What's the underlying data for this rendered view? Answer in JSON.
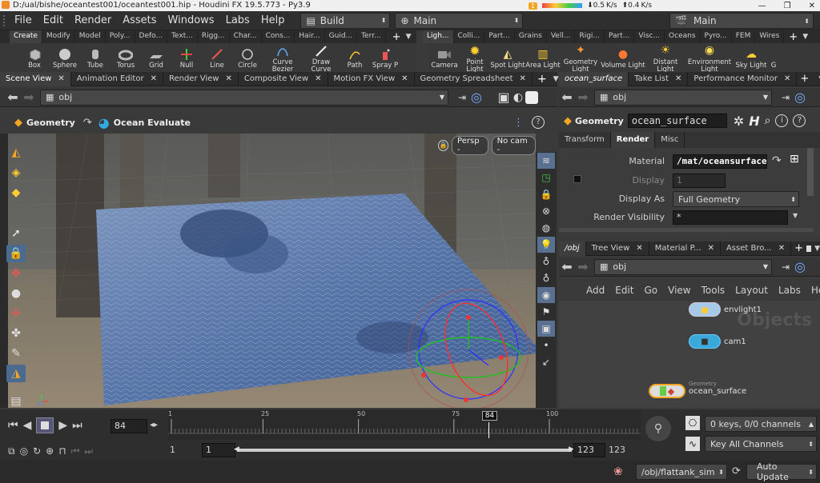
{
  "window": {
    "title": "D:/ual/bishe/oceantest001/oceantest001.hip - Houdini FX 19.5.773 - Py3.9",
    "sys_down": "0.5",
    "sys_up": "0.4",
    "sys_unit": "K/s"
  },
  "menu": {
    "items": [
      "File",
      "Edit",
      "Render",
      "Assets",
      "Windows",
      "Labs",
      "Help"
    ],
    "desktop": "Build",
    "network": "Main",
    "right_desktop": "Main"
  },
  "shelf_left": {
    "tabs": [
      "Create",
      "Modify",
      "Model",
      "Poly...",
      "Defo...",
      "Text...",
      "Rigg...",
      "Char...",
      "Cons...",
      "Hair...",
      "Guid...",
      "Terr..."
    ],
    "tools": [
      {
        "label": "Box",
        "icon": "box-icon"
      },
      {
        "label": "Sphere",
        "icon": "sphere-icon"
      },
      {
        "label": "Tube",
        "icon": "tube-icon"
      },
      {
        "label": "Torus",
        "icon": "torus-icon"
      },
      {
        "label": "Grid",
        "icon": "grid-icon"
      },
      {
        "label": "Null",
        "icon": "null-icon"
      },
      {
        "label": "Line",
        "icon": "line-icon"
      },
      {
        "label": "Circle",
        "icon": "circle-icon"
      },
      {
        "label": "Curve Bezier",
        "icon": "curve-bezier-icon"
      },
      {
        "label": "Draw Curve",
        "icon": "draw-curve-icon"
      },
      {
        "label": "Path",
        "icon": "path-icon"
      },
      {
        "label": "Spray P",
        "icon": "spray-paint-icon"
      }
    ]
  },
  "shelf_right": {
    "tabs": [
      "Ligh...",
      "Colli...",
      "Part...",
      "Grains",
      "Vell...",
      "Rigi...",
      "Part...",
      "Visc...",
      "Oceans",
      "Pyro...",
      "FEM",
      "Wires"
    ],
    "tools": [
      {
        "label": "Camera",
        "icon": "camera-icon"
      },
      {
        "label": "Point Light",
        "icon": "point-light-icon"
      },
      {
        "label": "Spot Light",
        "icon": "spot-light-icon"
      },
      {
        "label": "Area Light",
        "icon": "area-light-icon"
      },
      {
        "label": "Geometry Light",
        "icon": "geometry-light-icon"
      },
      {
        "label": "Volume Light",
        "icon": "volume-light-icon"
      },
      {
        "label": "Distant Light",
        "icon": "distant-light-icon"
      },
      {
        "label": "Environment Light",
        "icon": "environment-light-icon"
      },
      {
        "label": "Sky Light",
        "icon": "sky-light-icon"
      },
      {
        "label": "G",
        "icon": "more-icon"
      }
    ]
  },
  "left_panes": {
    "tabs": [
      "Scene View",
      "Animation Editor",
      "Render View",
      "Composite View",
      "Motion FX View",
      "Geometry Spreadsheet"
    ],
    "path": "obj"
  },
  "viewport": {
    "context": "Geometry",
    "node": "Ocean Evaluate",
    "camera": "Persp -",
    "cam_menu": "No cam -"
  },
  "params": {
    "tabs": [
      "ocean_surface",
      "Take List",
      "Performance Monitor"
    ],
    "path": "obj",
    "type": "Geometry",
    "node_name": "ocean_surface",
    "subtabs": [
      "Transform",
      "Render",
      "Misc"
    ],
    "material_label": "Material",
    "material_value": "/mat/oceansurface",
    "display_label": "Display",
    "display_value": "1",
    "display_as_label": "Display As",
    "display_as_value": "Full Geometry",
    "render_vis_label": "Render Visibility",
    "render_vis_value": "*"
  },
  "network": {
    "tabs": [
      "/obj",
      "Tree View",
      "Material P...",
      "Asset Bro..."
    ],
    "path": "obj",
    "menu": [
      "Add",
      "Edit",
      "Go",
      "View",
      "Tools",
      "Layout",
      "Labs",
      "Help"
    ],
    "watermark": "Objects",
    "nodes": [
      {
        "name": "envlight1",
        "icon": "envlight-icon"
      },
      {
        "name": "cam1",
        "icon": "camera-node-icon"
      },
      {
        "name": "ocean_surface",
        "type": "Geometry",
        "icon": "geometry-node-icon"
      }
    ]
  },
  "timeline": {
    "frame": "84",
    "ticks": [
      "1",
      "25",
      "50",
      "75",
      "100"
    ],
    "marker": "84",
    "range_start": "1",
    "start": "1",
    "end": "123",
    "range_end": "123",
    "current_frame": 84,
    "last_frame": 123
  },
  "channels": {
    "keys": "0 keys, 0/0 channels",
    "key_all": "Key All Channels"
  },
  "status": {
    "path": "/obj/flattank_sim",
    "update": "Auto Update"
  },
  "colors": {
    "accent": "#f5a623",
    "bg": "#3a3a3a",
    "water": "#4a6aa0",
    "select": "#ff8c00"
  }
}
